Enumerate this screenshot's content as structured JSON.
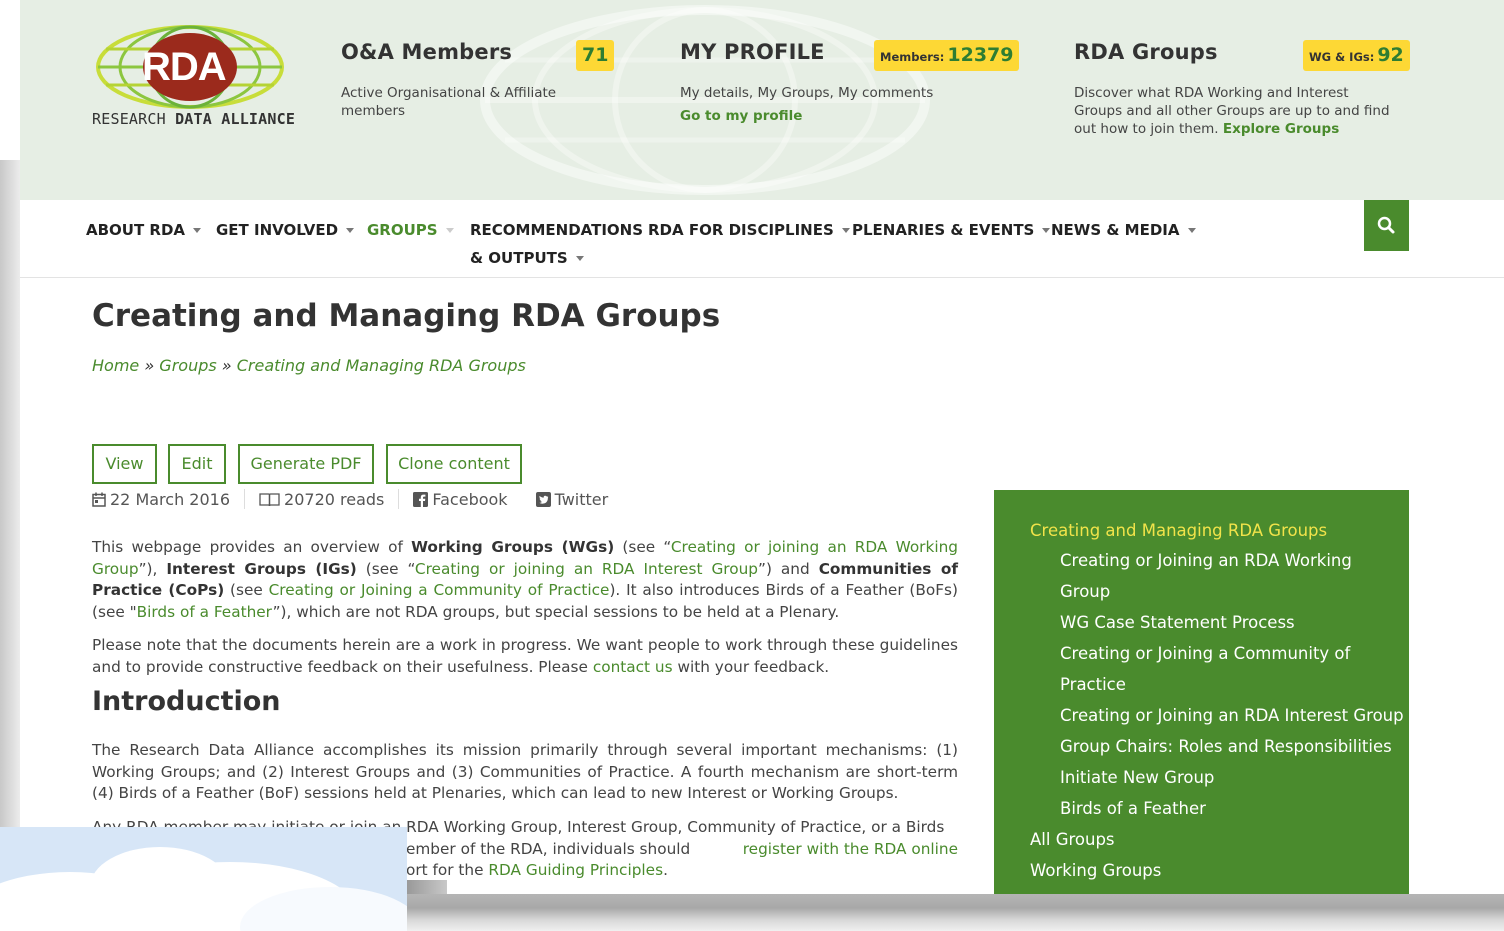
{
  "logo": {
    "mark": "RDA",
    "name_regular": "RESEARCH ",
    "name_bold": "DATA ALLIANCE"
  },
  "header": {
    "members": {
      "title": "O&A Members",
      "badge": "71",
      "desc": "Active Organisational & Affiliate members"
    },
    "profile": {
      "title": "MY PROFILE",
      "badge_label": "Members:",
      "badge_value": "12379",
      "desc": "My details, My Groups, My comments",
      "link": "Go to my profile"
    },
    "groups": {
      "title": "RDA Groups",
      "badge_label": "WG & IGs:",
      "badge_value": "92",
      "desc": "Discover what RDA Working and Interest Groups and all other Groups are up to and find out how to join them.",
      "link": "Explore Groups"
    }
  },
  "nav": {
    "items": [
      {
        "label": "ABOUT RDA"
      },
      {
        "label": "GET INVOLVED"
      },
      {
        "label": "GROUPS"
      },
      {
        "label": "RECOMMENDATIONS",
        "label2": "& OUTPUTS"
      },
      {
        "label": "RDA FOR DISCIPLINES"
      },
      {
        "label": "PLENARIES & EVENTS"
      },
      {
        "label": "NEWS & MEDIA"
      }
    ],
    "search_icon": "search-icon"
  },
  "page": {
    "title": "Creating and Managing RDA Groups",
    "breadcrumb": {
      "home": "Home",
      "sep": " » ",
      "groups": "Groups",
      "current": "Creating and Managing RDA Groups"
    },
    "actions": [
      "View",
      "Edit",
      "Generate PDF",
      "Clone content"
    ],
    "meta": {
      "date": "22 March 2016",
      "reads": "20720 reads",
      "facebook": "Facebook",
      "twitter": "Twitter"
    },
    "p1": {
      "t1": "This webpage provides an overview of ",
      "b1": "Working Groups (WGs)",
      "t2": " (see “",
      "l1": "Creating or joining an RDA Working Group",
      "t3": "”), ",
      "b2": "Interest Groups (IGs)",
      "t4": " (see “",
      "l2": "Creating or joining an RDA Interest Group",
      "t5": "”) and ",
      "b3": "Communities of Practice (CoPs)",
      "t6": " (see ",
      "l3": "Creating or Joining a Community of Practice",
      "t7": "). It also introduces Birds of a Feather (BoFs) (see \"",
      "l4": "Birds of a Feather",
      "t8": "”), which are not RDA groups, but special sessions to be held at a Plenary."
    },
    "p2": {
      "t1": "Please note that the documents herein are a work in progress. We want people to work through these guidelines and to provide constructive feedback on their usefulness. Please ",
      "l1": "contact us",
      "t2": " with your feedback."
    },
    "intro_heading": "Introduction",
    "p3": "The Research Data Alliance accomplishes its mission primarily through several important mechanisms: (1) Working Groups; and (2) Interest Groups and (3) Communities of Practice. A fourth mechanism are short-term (4) Birds of a Feather (BoF) sessions held at Plenaries, which can lead to new Interest or Working Groups.",
    "p4": {
      "t1": "Any RDA member may initiate or join an RDA Working Group, Interest Group, Community of Practice, or a Birds",
      "t2": "ember of the RDA, individuals should ",
      "l1": "register with the RDA online",
      "t3": "ort for the ",
      "l2": "RDA Guiding Principles",
      "t4": "."
    }
  },
  "sidebar": {
    "items": [
      {
        "label": "Creating and Managing RDA Groups"
      },
      {
        "label": "Creating or Joining an RDA Working"
      },
      {
        "label": "Group"
      },
      {
        "label": "WG Case Statement Process"
      },
      {
        "label": "Creating or Joining a Community of"
      },
      {
        "label": "Practice"
      },
      {
        "label": "Creating or Joining an RDA Interest Group"
      },
      {
        "label": "Group Chairs: Roles and Responsibilities"
      },
      {
        "label": "Initiate New Group"
      },
      {
        "label": "Birds of a Feather"
      },
      {
        "label": "All Groups"
      },
      {
        "label": "Working Groups"
      }
    ]
  },
  "colors": {
    "brand_green": "#4a8b2d",
    "badge_yellow": "#fdd835",
    "header_bg": "#e6eee4",
    "logo_red": "#9b2a1c",
    "sidebar_current": "#f1e34a"
  }
}
